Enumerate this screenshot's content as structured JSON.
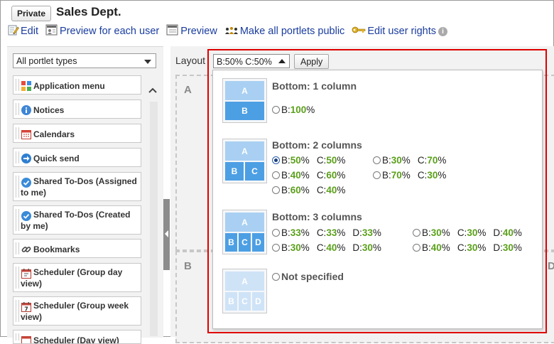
{
  "header": {
    "private_label": "Private",
    "title": "Sales Dept."
  },
  "toolbar": {
    "edit": "Edit",
    "preview_each": "Preview for each user",
    "preview": "Preview",
    "make_public": "Make all portlets public",
    "edit_rights": "Edit user rights"
  },
  "sidebar": {
    "filter_value": "All portlet types",
    "items": [
      {
        "label": "Application menu"
      },
      {
        "label": "Notices"
      },
      {
        "label": "Calendars"
      },
      {
        "label": "Quick send"
      },
      {
        "label": "Shared To-Dos (Assigned to me)"
      },
      {
        "label": "Shared To-Dos (Created by me)"
      },
      {
        "label": "Bookmarks"
      },
      {
        "label": "Scheduler (Group day view)"
      },
      {
        "label": "Scheduler (Group week view)"
      },
      {
        "label": "Scheduler (Day view)"
      }
    ]
  },
  "layout": {
    "label": "Layout",
    "selected": "B:50% C:50%",
    "apply": "Apply",
    "zones": {
      "a": "A",
      "b": "B",
      "d": "D"
    }
  },
  "dropdown": {
    "thumb_letters": {
      "a": "A",
      "b": "B",
      "c": "C",
      "d": "D"
    },
    "sections": [
      {
        "title": "Bottom: 1 column",
        "options": [
          {
            "parts": [
              {
                "k": "B:",
                "v": "100",
                "p": "%"
              }
            ],
            "selected": false
          }
        ]
      },
      {
        "title": "Bottom: 2 columns",
        "options": [
          {
            "parts": [
              {
                "k": "B:",
                "v": "50",
                "p": "%"
              },
              {
                "k": "C:",
                "v": "50",
                "p": "%"
              }
            ],
            "selected": true
          },
          {
            "parts": [
              {
                "k": "B:",
                "v": "30",
                "p": "%"
              },
              {
                "k": "C:",
                "v": "70",
                "p": "%"
              }
            ],
            "selected": false
          },
          {
            "parts": [
              {
                "k": "B:",
                "v": "40",
                "p": "%"
              },
              {
                "k": "C:",
                "v": "60",
                "p": "%"
              }
            ],
            "selected": false
          },
          {
            "parts": [
              {
                "k": "B:",
                "v": "70",
                "p": "%"
              },
              {
                "k": "C:",
                "v": "30",
                "p": "%"
              }
            ],
            "selected": false
          },
          {
            "parts": [
              {
                "k": "B:",
                "v": "60",
                "p": "%"
              },
              {
                "k": "C:",
                "v": "40",
                "p": "%"
              }
            ],
            "selected": false
          }
        ]
      },
      {
        "title": "Bottom: 3 columns",
        "options": [
          {
            "parts": [
              {
                "k": "B:",
                "v": "33",
                "p": "%"
              },
              {
                "k": "C:",
                "v": "33",
                "p": "%"
              },
              {
                "k": "D:",
                "v": "33",
                "p": "%"
              }
            ],
            "selected": false
          },
          {
            "parts": [
              {
                "k": "B:",
                "v": "30",
                "p": "%"
              },
              {
                "k": "C:",
                "v": "30",
                "p": "%"
              },
              {
                "k": "D:",
                "v": "40",
                "p": "%"
              }
            ],
            "selected": false
          },
          {
            "parts": [
              {
                "k": "B:",
                "v": "30",
                "p": "%"
              },
              {
                "k": "C:",
                "v": "40",
                "p": "%"
              },
              {
                "k": "D:",
                "v": "30",
                "p": "%"
              }
            ],
            "selected": false
          },
          {
            "parts": [
              {
                "k": "B:",
                "v": "40",
                "p": "%"
              },
              {
                "k": "C:",
                "v": "30",
                "p": "%"
              },
              {
                "k": "D:",
                "v": "30",
                "p": "%"
              }
            ],
            "selected": false
          }
        ]
      },
      {
        "title": "Not specified",
        "options": []
      }
    ]
  },
  "colors": {
    "highlight": "#e00000",
    "percent_value": "#5aa019",
    "link": "#1a3d9e"
  }
}
